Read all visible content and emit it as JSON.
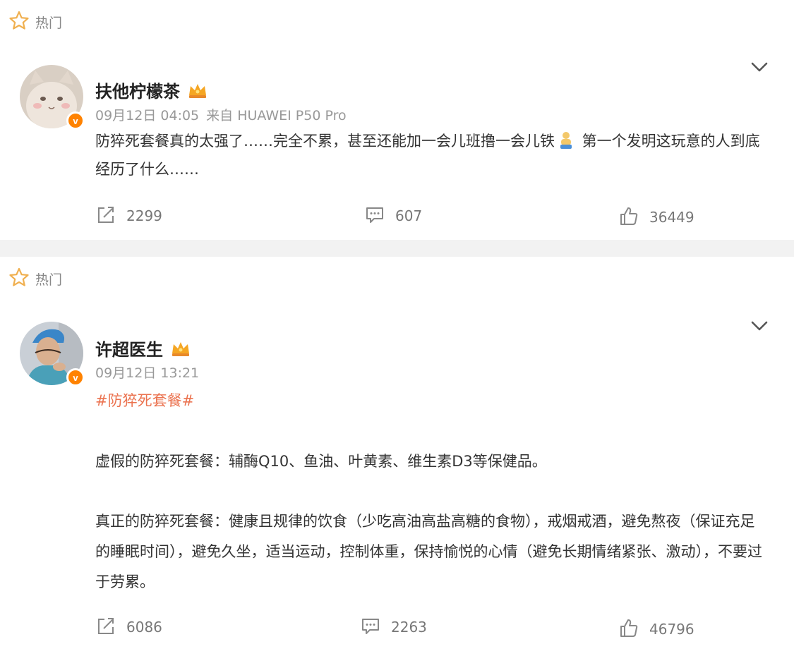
{
  "posts": [
    {
      "hot_label": "热门",
      "author": "扶他柠檬茶",
      "date": "09月12日 04:05",
      "source": "来自 HUAWEI P50 Pro",
      "text_part1": "防猝死套餐真的太强了……完全不累，甚至还能加一会儿班撸一会儿铁",
      "emoji": "bodybuilding-emoji",
      "text_part2": " 第一个发明这玩意的人到底经历了什么……",
      "reposts": "2299",
      "comments": "607",
      "likes": "36449"
    },
    {
      "hot_label": "热门",
      "author": "许超医生",
      "date": "09月12日 13:21",
      "hashtag": "#防猝死套餐#",
      "paragraph1": "虚假的防猝死套餐：辅酶Q10、鱼油、叶黄素、维生素D3等保健品。",
      "paragraph2": "真正的防猝死套餐：健康且规律的饮食（少吃高油高盐高糖的食物），戒烟戒酒，避免熬夜（保证充足的睡眠时间），避免久坐，适当运动，控制体重，保持愉悦的心情（避免长期情绪紧张、激动），不要过于劳累。",
      "reposts": "6086",
      "comments": "2263",
      "likes": "46796"
    }
  ],
  "verified_badge": "v",
  "colors": {
    "hot_star": "#f0b050",
    "hashtag": "#eb7350",
    "verified": "#ff8200",
    "icon_gray": "#888888"
  }
}
